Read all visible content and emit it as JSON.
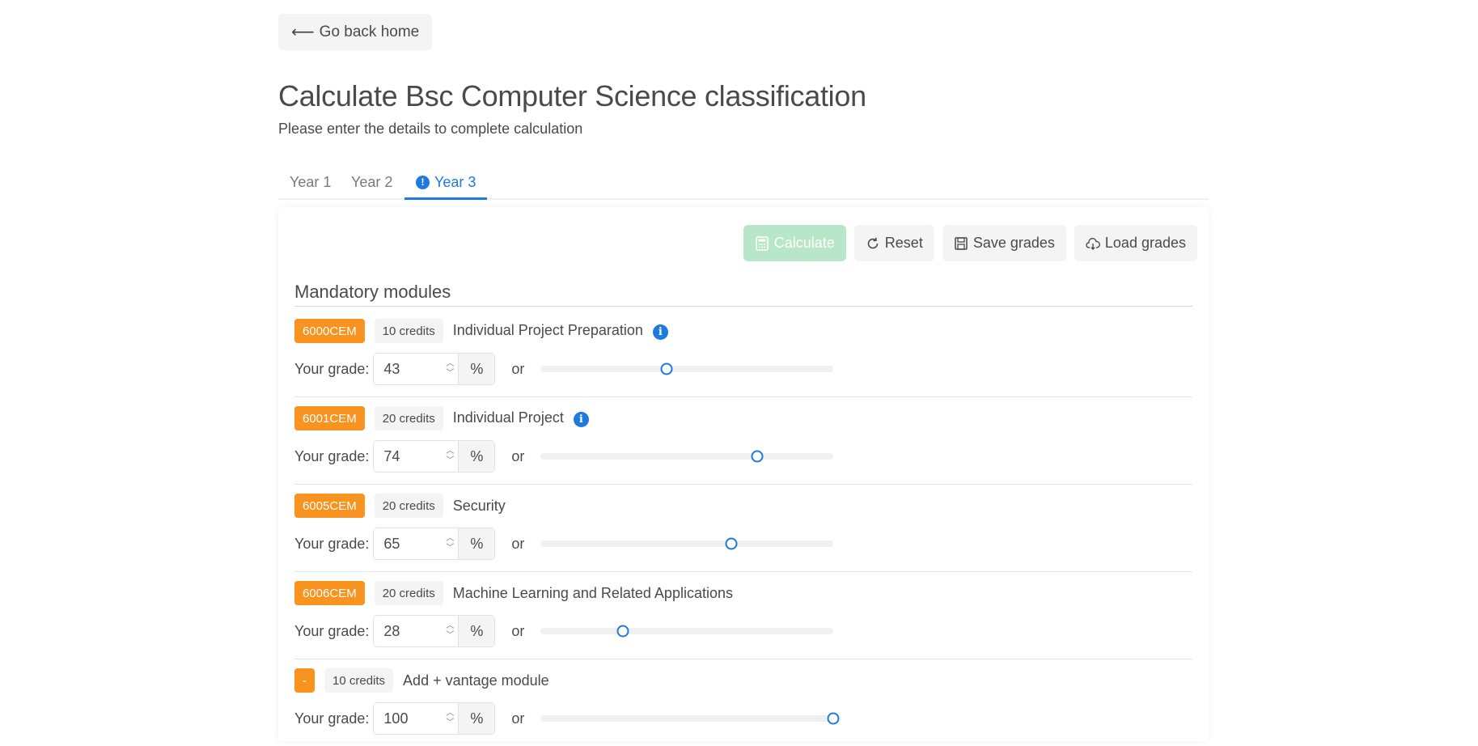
{
  "nav": {
    "back_label": "Go back home"
  },
  "page": {
    "title": "Calculate Bsc Computer Science classification",
    "subtitle": "Please enter the details to complete calculation"
  },
  "tabs": [
    {
      "label": "Year 1",
      "active": false
    },
    {
      "label": "Year 2",
      "active": false
    },
    {
      "label": "Year 3",
      "active": true,
      "icon": "exclamation-circle-icon"
    }
  ],
  "toolbar": {
    "calculate_label": "Calculate",
    "reset_label": "Reset",
    "save_label": "Save grades",
    "load_label": "Load grades"
  },
  "section": {
    "title": "Mandatory modules"
  },
  "grade_label": "Your grade:",
  "unit": "%",
  "or_label": "or",
  "modules": [
    {
      "code": "6000CEM",
      "credits": "10 credits",
      "name": "Individual Project Preparation",
      "grade": "43",
      "grade_value": 43,
      "has_info": true
    },
    {
      "code": "6001CEM",
      "credits": "20 credits",
      "name": "Individual Project",
      "grade": "74",
      "grade_value": 74,
      "has_info": true
    },
    {
      "code": "6005CEM",
      "credits": "20 credits",
      "name": "Security",
      "grade": "65",
      "grade_value": 65,
      "has_info": false
    },
    {
      "code": "6006CEM",
      "credits": "20 credits",
      "name": "Machine Learning and Related Applications",
      "grade": "28",
      "grade_value": 28,
      "has_info": false
    },
    {
      "code": "-",
      "credits": "10 credits",
      "name": "Add + vantage module",
      "grade": "100",
      "grade_value": 100,
      "has_info": false
    }
  ],
  "colors": {
    "accent": "#1f7ae0",
    "module_code": "#f7931e",
    "calculate_disabled": "#b8e6c8"
  }
}
